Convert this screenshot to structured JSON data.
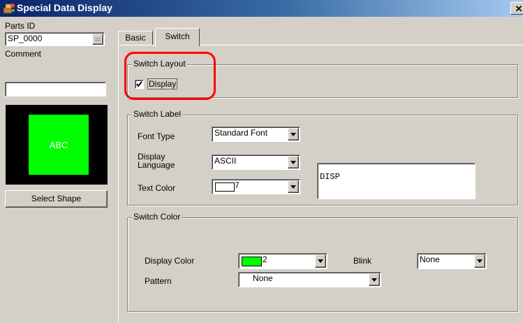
{
  "window": {
    "title": "Special Data Display",
    "close_glyph": "✕"
  },
  "left_panel": {
    "parts_id_label": "Parts ID",
    "parts_id_value": "SP_0000",
    "comment_label": "Comment",
    "comment_value": "",
    "preview_text": "ABC",
    "select_shape_label": "Select Shape"
  },
  "tabs": [
    {
      "label": "Basic",
      "active": false
    },
    {
      "label": "Switch",
      "active": true
    }
  ],
  "switch_layout": {
    "title": "Switch Layout",
    "display_label": "Display",
    "display_checked": true
  },
  "switch_label": {
    "title": "Switch Label",
    "font_type_label": "Font Type",
    "font_type_value": "Standard Font",
    "display_language_label_line1": "Display",
    "display_language_label_line2": "Language",
    "display_language_value": "ASCII",
    "text_color_label": "Text Color",
    "text_color_value": "7",
    "label_text": "DISP"
  },
  "switch_color": {
    "title": "Switch Color",
    "display_color_label": "Display Color",
    "display_color_value": "2",
    "blink_label": "Blink",
    "blink_value": "None",
    "pattern_label": "Pattern",
    "pattern_value": "None"
  },
  "colors": {
    "preview_green": "#00ff00",
    "preview_bg": "#000000",
    "highlight_red": "#ff0000",
    "swatch_white": "#ffffff",
    "swatch_green": "#00ff00"
  },
  "icons": {
    "app": "app-icon",
    "close": "close-icon",
    "dropdown": "chevron-down-icon",
    "spinner": "spinner-icon",
    "checkbox": "checkmark-icon"
  }
}
